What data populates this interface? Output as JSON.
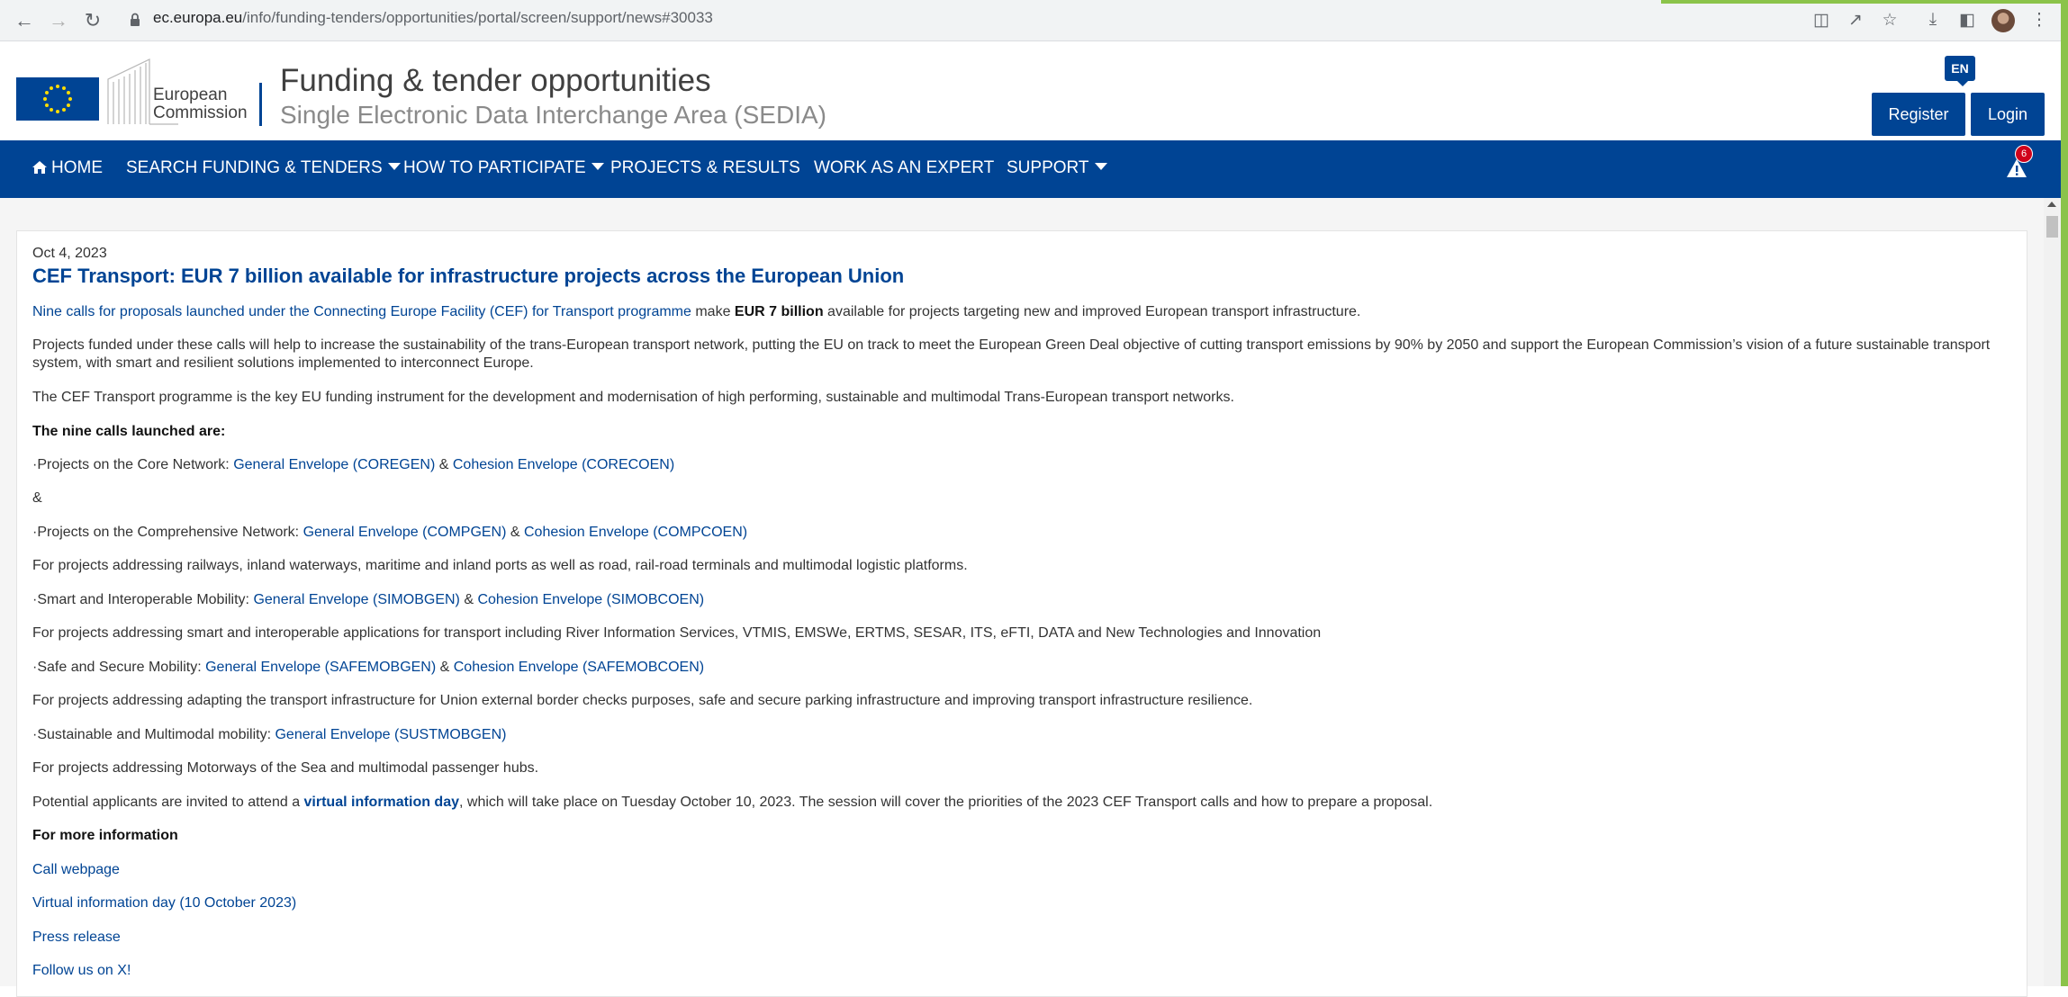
{
  "browser": {
    "url_domain": "ec.europa.eu",
    "url_path": "/info/funding-tenders/opportunities/portal/screen/support/news#30033"
  },
  "header": {
    "org_line1": "European",
    "org_line2": "Commission",
    "title": "Funding & tender opportunities",
    "subtitle": "Single Electronic Data Interchange Area (SEDIA)",
    "language": "EN",
    "register_label": "Register",
    "login_label": "Login"
  },
  "nav": {
    "home": "HOME",
    "search": "SEARCH FUNDING & TENDERS",
    "participate": "HOW TO PARTICIPATE",
    "projects": "PROJECTS & RESULTS",
    "expert": "WORK AS AN EXPERT",
    "support": "SUPPORT",
    "alert_count": "6"
  },
  "article": {
    "date": "Oct 4, 2023",
    "title": "CEF Transport: EUR 7 billion available for infrastructure projects across the European Union",
    "intro_link": "Nine calls for proposals launched under the Connecting Europe Facility (CEF) for Transport programme",
    "intro_make": " make ",
    "intro_bold": "EUR 7 billion",
    "intro_rest": " available for projects targeting new and improved European transport infrastructure.",
    "p2": "Projects funded under these calls will help to increase the sustainability of the trans-European transport network, putting the EU on track to meet the European Green Deal objective of cutting transport emissions by 90% by 2050 and support the European Commission’s vision of a future sustainable transport system, with smart and resilient solutions implemented to interconnect Europe.",
    "p3": "The CEF Transport programme is the key EU funding instrument for the development and modernisation of high performing, sustainable and multimodal Trans-European transport networks.",
    "calls_heading": "The nine calls launched are:",
    "core_prefix": "·Projects on the Core Network: ",
    "core_link1": "General Envelope (COREGEN)",
    "core_link2": "Cohesion Envelope (CORECOEN)",
    "amp": "&",
    "amp_spaced": " & ",
    "comp_prefix": "·Projects on the Comprehensive Network: ",
    "comp_link1": "General Envelope (COMPGEN)",
    "comp_link2": "Cohesion Envelope (COMPCOEN)",
    "comp_desc": "For projects addressing railways, inland waterways, maritime and inland ports as well as road, rail-road terminals and multimodal logistic platforms.",
    "smart_prefix": "·Smart and Interoperable Mobility: ",
    "smart_link1": "General Envelope (SIMOBGEN)",
    "smart_link2": "Cohesion Envelope (SIMOBCOEN)",
    "smart_desc": "For projects addressing smart and interoperable applications for transport including River Information Services, VTMIS, EMSWe, ERTMS, SESAR, ITS, eFTI, DATA and New Technologies and Innovation",
    "safe_prefix": "·Safe and Secure Mobility: ",
    "safe_link1": "General Envelope (SAFEMOBGEN)",
    "safe_link2": "Cohesion Envelope (SAFEMOBCOEN)",
    "safe_desc": "For projects addressing adapting the transport infrastructure for Union external border checks purposes, safe and secure parking infrastructure and improving transport infrastructure resilience.",
    "sust_prefix": "·Sustainable and Multimodal mobility: ",
    "sust_link1": "General Envelope (SUSTMOBGEN)",
    "sust_desc": "For projects addressing Motorways of the Sea and multimodal passenger hubs.",
    "info_pre": "Potential applicants are invited to attend a ",
    "info_link": "virtual information day",
    "info_post": ", which will take place on Tuesday October 10, 2023. The session will cover the priorities of the 2023 CEF Transport calls and how to prepare a proposal.",
    "more_heading": "For more information",
    "link_call": "Call webpage",
    "link_infoday": "Virtual information day (10 October 2023)",
    "link_press": "Press release",
    "link_follow": "Follow us on X!"
  }
}
